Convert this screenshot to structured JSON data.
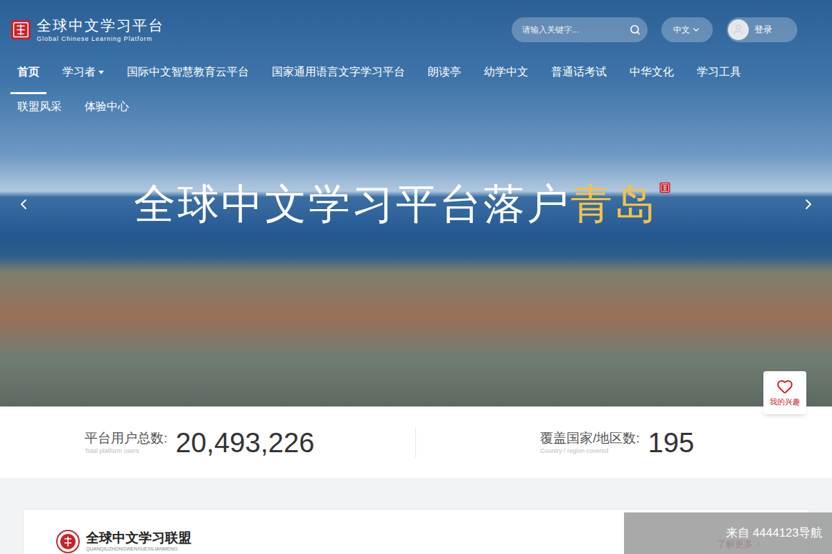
{
  "header": {
    "logo": {
      "title": "全球中文学习平台",
      "subtitle": "Global Chinese Learning Platform"
    },
    "search": {
      "placeholder": "请输入关键字..."
    },
    "language": "中文",
    "login": "登录"
  },
  "nav": {
    "rows": [
      [
        {
          "label": "首页",
          "selected": true,
          "dropdown": false
        },
        {
          "label": "学习者",
          "selected": false,
          "dropdown": true
        },
        {
          "label": "国际中文智慧教育云平台",
          "selected": false,
          "dropdown": false
        },
        {
          "label": "国家通用语言文字学习平台",
          "selected": false,
          "dropdown": false
        },
        {
          "label": "朗读亭",
          "selected": false,
          "dropdown": false
        },
        {
          "label": "幼学中文",
          "selected": false,
          "dropdown": false
        },
        {
          "label": "普通话考试",
          "selected": false,
          "dropdown": false
        },
        {
          "label": "中华文化",
          "selected": false,
          "dropdown": false
        },
        {
          "label": "学习工具",
          "selected": false,
          "dropdown": false
        }
      ],
      [
        {
          "label": "联盟风采",
          "selected": false,
          "dropdown": false
        },
        {
          "label": "体验中心",
          "selected": false,
          "dropdown": false
        }
      ]
    ]
  },
  "banner": {
    "title": "全球中文学习平台落户",
    "highlight": "青岛"
  },
  "interest_button": "我的兴趣",
  "stats": [
    {
      "label": "平台用户总数:",
      "sublabel": "Total platform users",
      "value": "20,493,226"
    },
    {
      "label": "覆盖国家/地区数:",
      "sublabel": "Country / region covered",
      "value": "195"
    }
  ],
  "alliance": {
    "title": "全球中文学习联盟",
    "subtitle": "QUANQIUZHONGWENXUEXILIANMENG",
    "more": "了解更多"
  },
  "watermark": "来自 4444123导航"
}
